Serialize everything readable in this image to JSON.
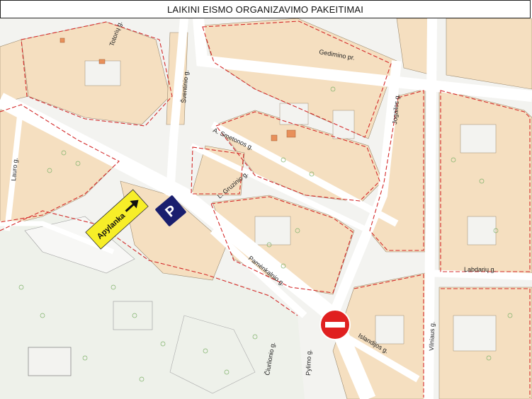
{
  "header": {
    "title": "LAIKINI EISMO ORGANIZAVIMO PAKEITIMAI"
  },
  "map": {
    "streets": [
      "Gedimino pr.",
      "Jogailos g.",
      "Vilniaus g.",
      "Šventinio g.",
      "A. Smetonos g.",
      "L. Gruzinio g.",
      "Pamėnkalnio g.",
      "Pylimo g.",
      "Labdarių g.",
      "Islandijos g.",
      "Totorių g.",
      "Čiurlionio g.",
      "Lauro g."
    ],
    "detour_sign": {
      "text": "Apylanka",
      "color": "#f7ee28",
      "arrow": "arrow-right-icon"
    },
    "parking_icon": {
      "text": "P",
      "color": "#1a1f6e"
    },
    "no_entry_sign": {
      "color": "#e02020"
    },
    "colors": {
      "building": "#f5dfc0",
      "building_outline": "#9b8a70",
      "zone_outline": "#d42a2a",
      "road": "#ffffff",
      "park": "#e8ede2"
    }
  }
}
